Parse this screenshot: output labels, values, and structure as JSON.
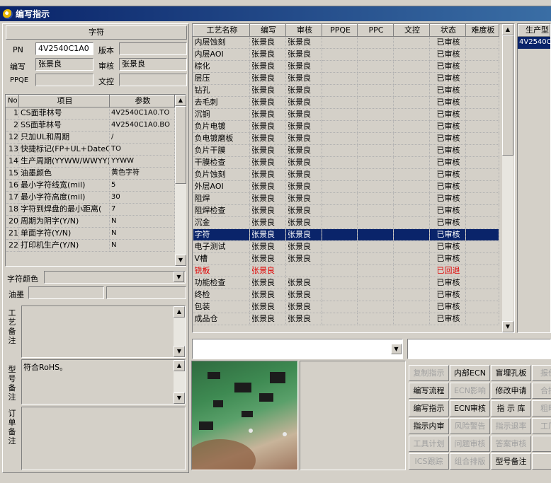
{
  "window": {
    "title": "编写指示"
  },
  "header": {
    "section_title": "字符",
    "pn_label": "PN",
    "pn_value": "4V2540C1A0",
    "version_label": "版本",
    "version_value": "",
    "author_label": "编写",
    "author_value": "张景良",
    "reviewer_label": "审核",
    "reviewer_value": "张景良",
    "ppqe_label": "PPQE",
    "ppqe_value": "",
    "doc_label": "文控",
    "doc_value": ""
  },
  "params": {
    "columns": [
      "No",
      "项目",
      "参数"
    ],
    "rows": [
      {
        "no": "1",
        "item": "CS面菲林号",
        "value": "4V2540C1A0.TO"
      },
      {
        "no": "2",
        "item": "SS面菲林号",
        "value": "4V2540C1A0.BO"
      },
      {
        "no": "12",
        "item": "只加UL和周期",
        "value": "/"
      },
      {
        "no": "13",
        "item": "快捷标记(FP+UL+DateCo",
        "value": "TO"
      },
      {
        "no": "14",
        "item": "生产周期(YYWW/WWYY)",
        "value": "YYWW"
      },
      {
        "no": "15",
        "item": "油墨颜色",
        "value": "黄色字符"
      },
      {
        "no": "16",
        "item": "最小字符线宽(mil)",
        "value": "5"
      },
      {
        "no": "17",
        "item": "最小字符高度(mil)",
        "value": "30"
      },
      {
        "no": "18",
        "item": "字符到焊盘的最小距离(",
        "value": "7"
      },
      {
        "no": "20",
        "item": "周期为阴字(Y/N)",
        "value": "N"
      },
      {
        "no": "21",
        "item": "单面字符(Y/N)",
        "value": "N"
      },
      {
        "no": "22",
        "item": "打印机生产(Y/N)",
        "value": "N"
      }
    ]
  },
  "char_color": {
    "label": "字符颜色",
    "value": ""
  },
  "ink": {
    "label": "油墨",
    "value1": "",
    "value2": ""
  },
  "notes": {
    "process_label": "工艺备注",
    "process_value": "",
    "model_label": "型号备注",
    "model_value": "符合RoHS。",
    "order_label": "订单备注",
    "order_value": ""
  },
  "process_table": {
    "columns": [
      "工艺名称",
      "编写",
      "审核",
      "PPQE",
      "PPC",
      "文控",
      "状态",
      "难度板"
    ],
    "rows": [
      {
        "name": "内层蚀刻",
        "author": "张景良",
        "reviewer": "张景良",
        "status": "已审核"
      },
      {
        "name": "内层AOI",
        "author": "张景良",
        "reviewer": "张景良",
        "status": "已审核"
      },
      {
        "name": "棕化",
        "author": "张景良",
        "reviewer": "张景良",
        "status": "已审核"
      },
      {
        "name": "层压",
        "author": "张景良",
        "reviewer": "张景良",
        "status": "已审核"
      },
      {
        "name": "钻孔",
        "author": "张景良",
        "reviewer": "张景良",
        "status": "已审核"
      },
      {
        "name": "去毛刺",
        "author": "张景良",
        "reviewer": "张景良",
        "status": "已审核"
      },
      {
        "name": "沉铜",
        "author": "张景良",
        "reviewer": "张景良",
        "status": "已审核"
      },
      {
        "name": "负片电镀",
        "author": "张景良",
        "reviewer": "张景良",
        "status": "已审核"
      },
      {
        "name": "负电镀磨板",
        "author": "张景良",
        "reviewer": "张景良",
        "status": "已审核"
      },
      {
        "name": "负片干膜",
        "author": "张景良",
        "reviewer": "张景良",
        "status": "已审核"
      },
      {
        "name": "干膜检查",
        "author": "张景良",
        "reviewer": "张景良",
        "status": "已审核"
      },
      {
        "name": "负片蚀刻",
        "author": "张景良",
        "reviewer": "张景良",
        "status": "已审核"
      },
      {
        "name": "外层AOI",
        "author": "张景良",
        "reviewer": "张景良",
        "status": "已审核"
      },
      {
        "name": "阻焊",
        "author": "张景良",
        "reviewer": "张景良",
        "status": "已审核"
      },
      {
        "name": "阻焊检查",
        "author": "张景良",
        "reviewer": "张景良",
        "status": "已审核"
      },
      {
        "name": "沉金",
        "author": "张景良",
        "reviewer": "张景良",
        "status": "已审核"
      },
      {
        "name": "字符",
        "author": "张景良",
        "reviewer": "张景良",
        "status": "已审核",
        "selected": true
      },
      {
        "name": "电子测试",
        "author": "张景良",
        "reviewer": "张景良",
        "status": "已审核"
      },
      {
        "name": "V槽",
        "author": "张景良",
        "reviewer": "张景良",
        "status": "已审核"
      },
      {
        "name": "铣板",
        "author": "张景良",
        "reviewer": "",
        "status": "已回退",
        "rejected": true
      },
      {
        "name": "功能检查",
        "author": "张景良",
        "reviewer": "张景良",
        "status": "已审核"
      },
      {
        "name": "终检",
        "author": "张景良",
        "reviewer": "张景良",
        "status": "已审核"
      },
      {
        "name": "包装",
        "author": "张景良",
        "reviewer": "张景良",
        "status": "已审核"
      },
      {
        "name": "成品仓",
        "author": "张景良",
        "reviewer": "张景良",
        "status": "已审核"
      }
    ]
  },
  "model_panel": {
    "header": "生产型",
    "value": "4V2540C"
  },
  "buttons": [
    {
      "label": "复制指示",
      "enabled": false
    },
    {
      "label": "内部ECN",
      "enabled": true
    },
    {
      "label": "盲埋孔板",
      "enabled": true
    },
    {
      "label": "报价条",
      "enabled": false
    },
    {
      "label": "编写流程",
      "enabled": true
    },
    {
      "label": "ECN影响",
      "enabled": false
    },
    {
      "label": "修改申请",
      "enabled": true
    },
    {
      "label": "合拼条",
      "enabled": false
    },
    {
      "label": "编写指示",
      "enabled": true
    },
    {
      "label": "ECN审核",
      "enabled": true
    },
    {
      "label": "指 示 库",
      "enabled": true
    },
    {
      "label": "粗略拼",
      "enabled": false
    },
    {
      "label": "指示内审",
      "enabled": true
    },
    {
      "label": "风险警告",
      "enabled": false
    },
    {
      "label": "指示退率",
      "enabled": false
    },
    {
      "label": "工厂警",
      "enabled": false
    },
    {
      "label": "工具计划",
      "enabled": false
    },
    {
      "label": "问题审核",
      "enabled": false
    },
    {
      "label": "答案审核",
      "enabled": false
    },
    {
      "label": "",
      "enabled": false
    },
    {
      "label": "ICS跟踪",
      "enabled": false
    },
    {
      "label": "组合排版",
      "enabled": false
    },
    {
      "label": "型号备注",
      "enabled": true
    },
    {
      "label": "",
      "enabled": false
    }
  ],
  "colors": {
    "title_bar": "#0a246a",
    "selection": "#0a246a",
    "rejected_text": "#e00000"
  }
}
